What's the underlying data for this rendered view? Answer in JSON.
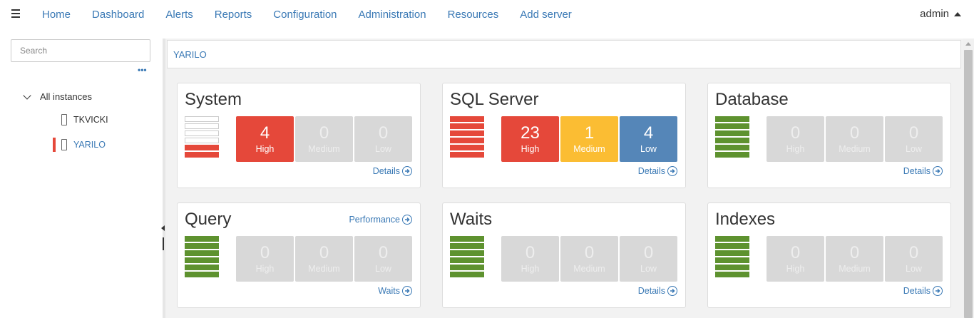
{
  "nav": {
    "links": [
      "Home",
      "Dashboard",
      "Alerts",
      "Reports",
      "Configuration",
      "Administration",
      "Resources",
      "Add server"
    ],
    "user": "admin"
  },
  "sidebar": {
    "search_placeholder": "Search",
    "more": "•••",
    "root": "All instances",
    "instances": [
      {
        "name": "TKVICKI",
        "selected": false
      },
      {
        "name": "YARILO",
        "selected": true
      }
    ]
  },
  "breadcrumb": "YARILO",
  "colors": {
    "accent": "#3a79b5",
    "high": "#e5483a",
    "medium": "#fbbd33",
    "low": "#5586b8",
    "ok": "#5e922f",
    "disabled": "#d8d8d8"
  },
  "cards": [
    {
      "title": "System",
      "bars": [
        "empty",
        "empty",
        "empty",
        "empty",
        "red",
        "red"
      ],
      "high": "4",
      "medium": "0",
      "low": "0",
      "active": [
        true,
        false,
        false
      ],
      "link": "Details",
      "top_link": ""
    },
    {
      "title": "SQL Server",
      "bars": [
        "red",
        "red",
        "red",
        "red",
        "red",
        "red"
      ],
      "high": "23",
      "medium": "1",
      "low": "4",
      "active": [
        true,
        true,
        true
      ],
      "link": "Details",
      "top_link": ""
    },
    {
      "title": "Database",
      "bars": [
        "green",
        "green",
        "green",
        "green",
        "green",
        "green"
      ],
      "high": "0",
      "medium": "0",
      "low": "0",
      "active": [
        false,
        false,
        false
      ],
      "link": "Details",
      "top_link": ""
    },
    {
      "title": "Query",
      "bars": [
        "green",
        "green",
        "green",
        "green",
        "green",
        "green"
      ],
      "high": "0",
      "medium": "0",
      "low": "0",
      "active": [
        false,
        false,
        false
      ],
      "link": "Waits",
      "top_link": "Performance"
    },
    {
      "title": "Waits",
      "bars": [
        "green",
        "green",
        "green",
        "green",
        "green",
        "green"
      ],
      "high": "0",
      "medium": "0",
      "low": "0",
      "active": [
        false,
        false,
        false
      ],
      "link": "Details",
      "top_link": ""
    },
    {
      "title": "Indexes",
      "bars": [
        "green",
        "green",
        "green",
        "green",
        "green",
        "green"
      ],
      "high": "0",
      "medium": "0",
      "low": "0",
      "active": [
        false,
        false,
        false
      ],
      "link": "Details",
      "top_link": ""
    }
  ],
  "labels": {
    "high": "High",
    "medium": "Medium",
    "low": "Low"
  }
}
